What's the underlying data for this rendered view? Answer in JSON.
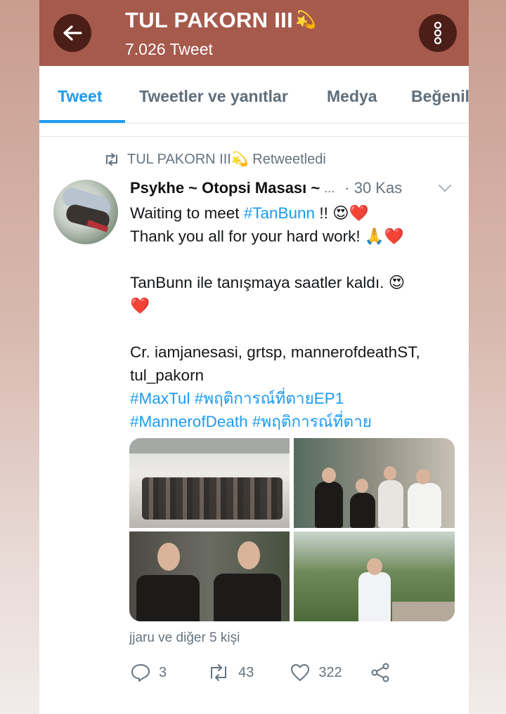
{
  "header": {
    "title": "TUL PAKORN III",
    "title_emoji": "💫",
    "tweet_count": "7.026 Tweet"
  },
  "tabs": [
    {
      "label": "Tweet",
      "active": true
    },
    {
      "label": "Tweetler ve yanıtlar",
      "active": false
    },
    {
      "label": "Medya",
      "active": false
    },
    {
      "label": "Beğenil",
      "active": false
    }
  ],
  "tweet": {
    "retweeted_by": "TUL PAKORN III💫 Retweetledi",
    "author_name": "Psykhe ~ Otopsi Masası ~",
    "author_more": "...",
    "date": "· 30 Kas",
    "lines": [
      {
        "parts": [
          {
            "text": "Waiting to meet "
          },
          {
            "text": "#TanBunn",
            "tag": true
          },
          {
            "text": " !! 😍❤️"
          }
        ]
      },
      {
        "parts": [
          {
            "text": "Thank you all for your hard work! 🙏❤️"
          }
        ]
      },
      {
        "blank": true
      },
      {
        "parts": [
          {
            "text": "TanBunn ile tanışmaya saatler kaldı. 😍"
          }
        ]
      },
      {
        "parts": [
          {
            "text": "❤️"
          }
        ]
      },
      {
        "blank": true
      },
      {
        "parts": [
          {
            "text": "Cr. iamjanesasi, grtsp, mannerofdeathST,"
          }
        ]
      },
      {
        "parts": [
          {
            "text": "tul_pakorn"
          }
        ]
      },
      {
        "parts": [
          {
            "text": "#MaxTul #พฤติการณ์ที่ตายEP1",
            "tag": true
          }
        ]
      },
      {
        "parts": [
          {
            "text": "#MannerofDeath #พฤติการณ์ที่ตาย",
            "tag": true
          }
        ]
      }
    ],
    "liked_by": "jjaru ve diğer 5 kişi",
    "replies": "3",
    "retweets": "43",
    "likes": "322"
  },
  "colors": {
    "header_bg": "#a65a4c",
    "button_bg": "#4b1f18",
    "accent": "#1d9bf0",
    "muted": "#65737f"
  },
  "icons": [
    "back-arrow-icon",
    "more-vertical-icon",
    "retweet-icon",
    "chevron-down-icon",
    "reply-icon",
    "heart-icon",
    "share-icon"
  ]
}
